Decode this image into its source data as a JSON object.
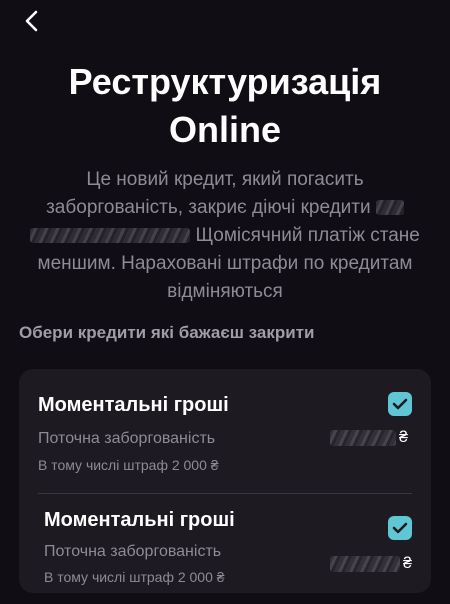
{
  "header": {
    "back_icon": "chevron-left-icon"
  },
  "title": {
    "line1": "Реструктуризація",
    "line2": "Online"
  },
  "description": {
    "line1": "Це новий кредит, який погасить",
    "line2": "заборгованість, закриє діючі  кредити",
    "line3": "Щомісячний платіж стане",
    "line4": "меншим. Нараховані штрафи по кредитам",
    "line5": "відміняються"
  },
  "section_label": "Обери кредити які бажаєш закрити",
  "credits": [
    {
      "name": "Моментальні гроші",
      "debt_label": "Поточна заборгованість",
      "currency": "₴",
      "penalty": "В тому числі штраф 2 000 ₴",
      "checked": true
    },
    {
      "name": "Моментальні гроші",
      "debt_label": "Поточна заборгованість",
      "currency": "₴",
      "penalty": "В тому числі штраф 2 000 ₴",
      "checked": true
    }
  ],
  "colors": {
    "background": "#110d14",
    "card": "#1e1a22",
    "accent": "#5fc6d3",
    "muted_text": "#8e8a96"
  }
}
